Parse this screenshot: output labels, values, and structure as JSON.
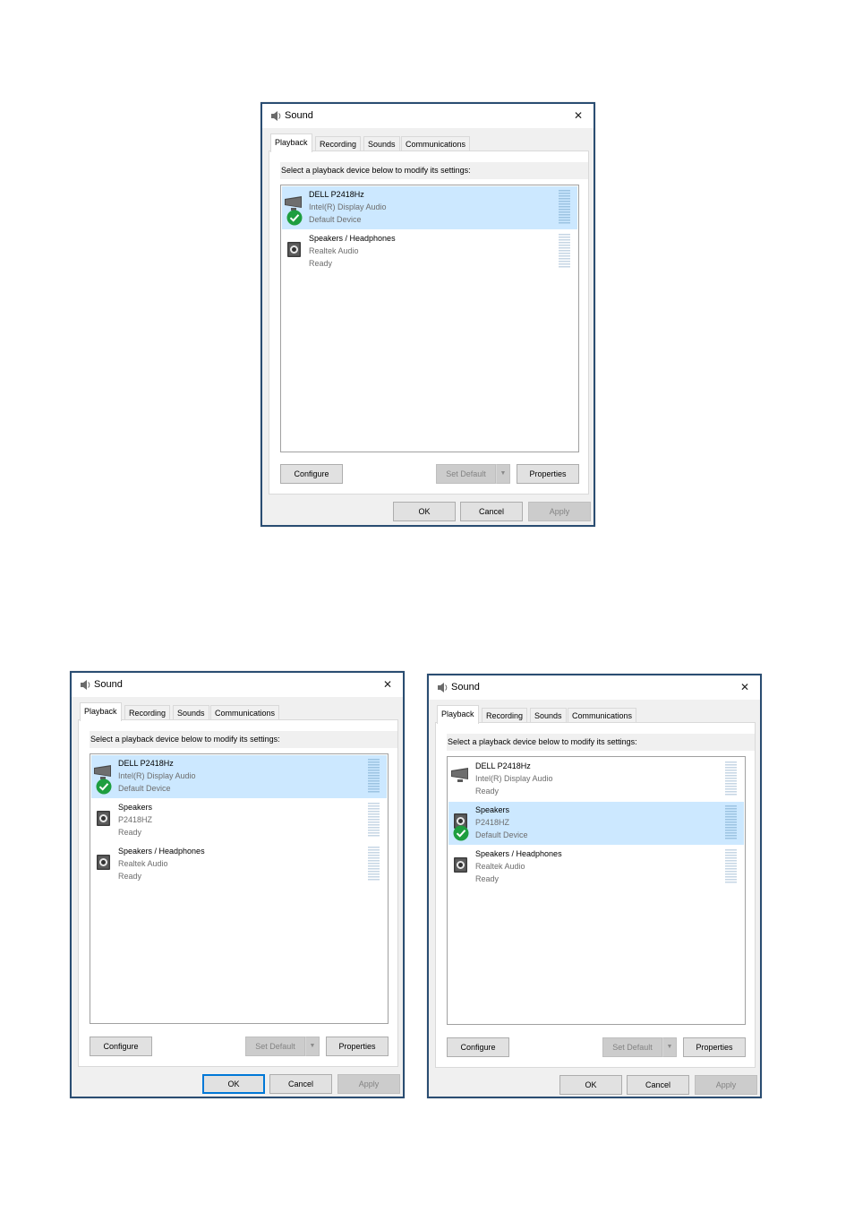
{
  "window": {
    "title": "Sound",
    "close_glyph": "✕",
    "tabs": [
      "Playback",
      "Recording",
      "Sounds",
      "Communications"
    ],
    "instruction": "Select a playback device below to modify its settings:"
  },
  "buttons": {
    "configure": "Configure",
    "set_default": "Set Default",
    "properties": "Properties",
    "ok": "OK",
    "cancel": "Cancel",
    "apply": "Apply"
  },
  "dialogs": [
    {
      "devices": [
        {
          "name": "DELL P2418Hz",
          "driver": "Intel(R) Display Audio",
          "status": "Default Device",
          "icon": "monitor-icon",
          "selected": true,
          "default": true
        },
        {
          "name": "Speakers / Headphones",
          "driver": "Realtek Audio",
          "status": "Ready",
          "icon": "speaker-icon",
          "selected": false,
          "default": false
        }
      ]
    },
    {
      "devices": [
        {
          "name": "DELL P2418Hz",
          "driver": "Intel(R) Display Audio",
          "status": "Default Device",
          "icon": "monitor-icon",
          "selected": true,
          "default": true
        },
        {
          "name": "Speakers",
          "driver": "P2418HZ",
          "status": "Ready",
          "icon": "speaker-icon",
          "selected": false,
          "default": false
        },
        {
          "name": "Speakers / Headphones",
          "driver": "Realtek Audio",
          "status": "Ready",
          "icon": "speaker-icon",
          "selected": false,
          "default": false
        }
      ]
    },
    {
      "devices": [
        {
          "name": "DELL P2418Hz",
          "driver": "Intel(R) Display Audio",
          "status": "Ready",
          "icon": "monitor-icon",
          "selected": false,
          "default": false
        },
        {
          "name": "Speakers",
          "driver": "P2418HZ",
          "status": "Default Device",
          "icon": "speaker-icon",
          "selected": true,
          "default": true
        },
        {
          "name": "Speakers / Headphones",
          "driver": "Realtek Audio",
          "status": "Ready",
          "icon": "speaker-icon",
          "selected": false,
          "default": false
        }
      ]
    }
  ],
  "colors": {
    "selection": "#cce8ff",
    "check_green": "#1e9e3f",
    "dialog_bg": "#f0f0f0",
    "border_blue": "#0078d7"
  }
}
